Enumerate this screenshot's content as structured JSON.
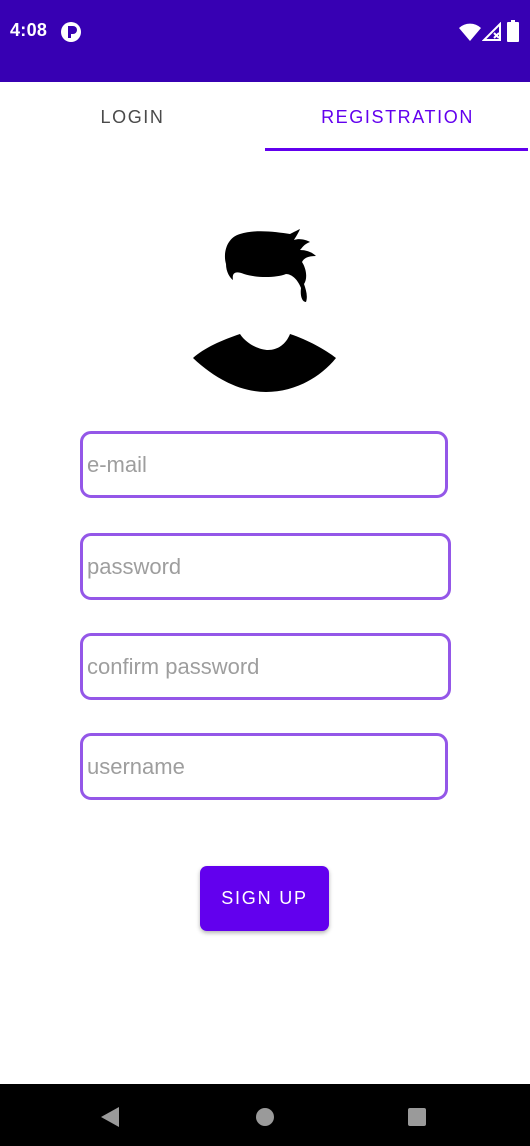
{
  "status_bar": {
    "time": "4:08",
    "background_color": "#3700B3",
    "icons": [
      "notification-icon",
      "wifi-icon",
      "signal-icon",
      "battery-icon"
    ]
  },
  "tabs": [
    {
      "label": "LOGIN",
      "selected": false
    },
    {
      "label": "REGISTRATION",
      "selected": true
    }
  ],
  "accent_color": "#6200EE",
  "field_border_color": "#9457E8",
  "avatar": {
    "icon": "user-avatar-icon"
  },
  "form": {
    "email_placeholder": "e-mail",
    "email_value": "",
    "password_placeholder": "password",
    "password_value": "",
    "confirm_password_placeholder": "confirm password",
    "confirm_password_value": "",
    "username_placeholder": "username",
    "username_value": "",
    "submit_label": "SIGN UP"
  },
  "nav_bar": {
    "icons": [
      "back-icon",
      "home-icon",
      "recents-icon"
    ]
  }
}
